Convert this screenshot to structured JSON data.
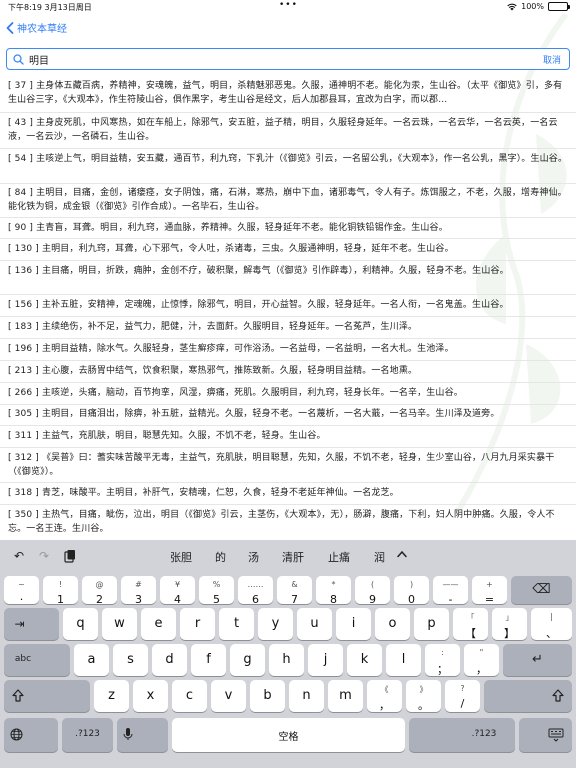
{
  "status_bar": {
    "time_date": "下午8:19   3月13日周日",
    "dots": "•••",
    "battery": "100%"
  },
  "nav": {
    "back_label": "神农本草经"
  },
  "search": {
    "value": "明目",
    "cancel_label": "取消"
  },
  "results": [
    "[ 37 ] 主身体五藏百病，养精神，安魂魄，益气，明目，杀精魅邪恶鬼。久服，通神明不老。能化为汞，生山谷。（太平《御览》引，多有生山谷三字，《大观本》，作生符陵山谷，俱作黑字，考生山谷是经文，后人加郡县耳，宜改为白字，而以郡...",
    "[ 43 ] 主身皮死肌，中风寒热，如在车船上，除邪气，安五脏，益子精，明目，久服轻身延年。一名云珠，一名云华，一名云英，一名云液，一名云沙，一名磷石，生山谷。",
    "[ 54 ] 主咳逆上气，明目益精，安五藏，通百节，利九窍，下乳汁（《御览》引云，一名留公乳，《大观本》，作一名公乳，黑字）。生山谷。",
    "[ 84 ] 主明目，目痛，金创，诸瘘痉，女子阴蚀，痛，石淋，寒热，崩中下血，诸邪毒气，令人有子。炼饵服之，不老，久服，增寿神仙。能化铁为铜，成金银（《御览》引作合成）。一名毕石，生山谷。",
    "[ 90 ] 主青盲，耳聋。明目，利九窍，通血脉，养精神。久服，轻身延年不老。能化铜铁铅锡作金。生山谷。",
    "[ 130 ] 主明目，利九窍，耳聋，心下邪气，令人吐，杀诸毒，三虫。久服通神明，轻身，延年不老。生山谷。",
    "[ 136 ] 主目痛，明目，折跌，痈肿，金创不疗，破积聚，解毒气（《御览》引作辟毒），利精神。久服，轻身不老。生山谷。",
    "[ 156 ] 主补五脏，安精神，定魂魄，止惊悸，除邪气，明目，开心益智。久服，轻身延年。一名人衔，一名鬼盖。生山谷。",
    "[ 183 ] 主续绝伤，补不足，益气力，肥健，汁，去面皯。久服明目，轻身延年。一名菟芦，生川泽。",
    "[ 196 ] 主明目益精，除水气。久服轻身，茎生癣疹痒，可作浴汤。一名益母，一名益明，一名大札。生池泽。",
    "[ 213 ] 主心腹，去肠胃中结气，饮食积聚，寒热邪气，推陈致新。久服，轻身明目益精。一名地熏。",
    "[ 266 ] 主咳逆，头痛，脑动，百节拘挛，风湿，痹痛，死肌。久服明目，利九窍，轻身长年。一名辛，生山谷。",
    "[ 305 ] 主明目，目痛泪出，除痹，补五脏，益精光。久服，轻身不老。一名蔑析，一名大蕺，一名马辛。生川泽及道旁。",
    "[ 311 ] 主益气，充肌肤，明目，聪慧先知。久服，不饥不老，轻身。生山谷。",
    "[ 312 ] 《吴普》曰：蓍实味苦酸平无毒，主益气，充肌肤，明目聪慧，先知，久服，不饥不老，轻身，生少室山谷，八月九月采实暴干（《御览》）。",
    "[ 318 ] 青芝，味酸平。主明目，补肝气，安精魂，仁恕，久食，轻身不老延年神仙。一名龙芝。",
    "[ 350 ] 主热气，目痛，眦伤，泣出，明目（《御览》引云，主茎伤，《大观本》，无），肠澼，腹痛，下利，妇人阴中肿痛。久服，令人不忘。一名王连。生川谷。"
  ],
  "suggestions": [
    "张胆",
    "的",
    "汤",
    "清肝",
    "止痛",
    "润"
  ],
  "keyboard": {
    "number_row": [
      {
        "sub": "~",
        "main": "·"
      },
      {
        "sub": "!",
        "main": "1"
      },
      {
        "sub": "@",
        "main": "2"
      },
      {
        "sub": "#",
        "main": "3"
      },
      {
        "sub": "¥",
        "main": "4"
      },
      {
        "sub": "%",
        "main": "5"
      },
      {
        "sub": "……",
        "main": "6"
      },
      {
        "sub": "&",
        "main": "7"
      },
      {
        "sub": "*",
        "main": "8"
      },
      {
        "sub": "(",
        "main": "9"
      },
      {
        "sub": ")",
        "main": "0"
      },
      {
        "sub": "——",
        "main": "-"
      },
      {
        "sub": "+",
        "main": "="
      }
    ],
    "row1": [
      "q",
      "w",
      "e",
      "r",
      "t",
      "y",
      "u",
      "i",
      "o",
      "p"
    ],
    "row1_extra": [
      {
        "sub": "「",
        "main": "【"
      },
      {
        "sub": "」",
        "main": "】"
      },
      {
        "sub": "|",
        "main": "、"
      }
    ],
    "row2": [
      "a",
      "s",
      "d",
      "f",
      "g",
      "h",
      "j",
      "k",
      "l"
    ],
    "row2_extra": [
      {
        "sub": ":",
        "main": "；"
      },
      {
        "sub": "\"",
        "main": "，"
      }
    ],
    "row3": [
      "z",
      "x",
      "c",
      "v",
      "b",
      "n",
      "m"
    ],
    "row3_extra": [
      {
        "sub": "《",
        "main": "，"
      },
      {
        "sub": "》",
        "main": "。"
      },
      {
        "sub": "?",
        "main": "/"
      }
    ],
    "tab_label": "⇥",
    "abc_label": "abc",
    "numeric_label": ".?123",
    "space_label": "空格",
    "delete_label": "⌫",
    "return_label": "↵"
  }
}
